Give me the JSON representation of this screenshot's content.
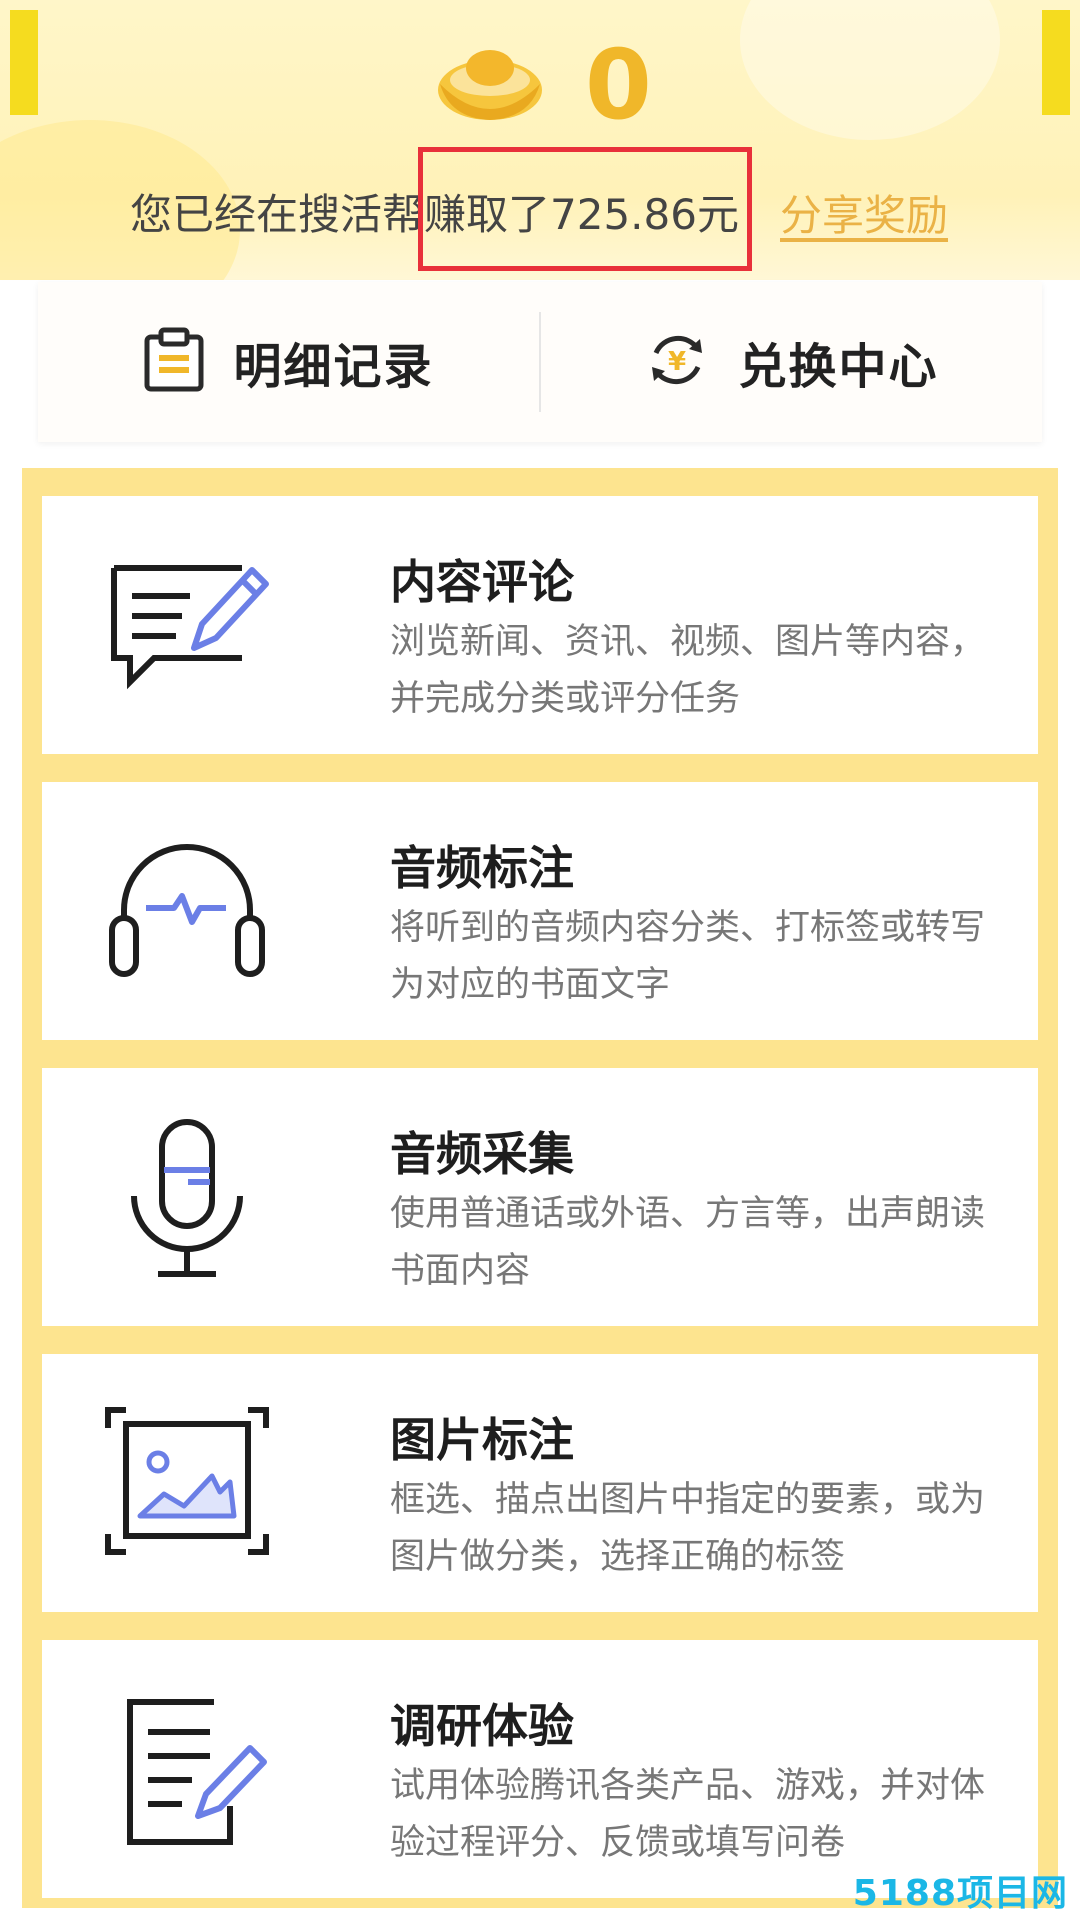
{
  "header": {
    "coin_value": "0",
    "earn_prefix": "您已经在搜活帮",
    "earn_highlight": "赚取了725.86元",
    "share_label": "分享奖励"
  },
  "actions": [
    {
      "label": "明细记录",
      "icon": "clipboard-icon"
    },
    {
      "label": "兑换中心",
      "icon": "yuan-exchange-icon"
    }
  ],
  "tasks": [
    {
      "title": "内容评论",
      "desc": "浏览新闻、资讯、视频、图片等内容，并完成分类或评分任务",
      "icon": "comment-edit-icon"
    },
    {
      "title": "音频标注",
      "desc": "将听到的音频内容分类、打标签或转写为对应的书面文字",
      "icon": "headphones-icon"
    },
    {
      "title": "音频采集",
      "desc": "使用普通话或外语、方言等，出声朗读书面内容",
      "icon": "microphone-icon"
    },
    {
      "title": "图片标注",
      "desc": "框选、描点出图片中指定的要素，或为图片做分类，选择正确的标签",
      "icon": "image-frame-icon"
    },
    {
      "title": "调研体验",
      "desc": "试用体验腾讯各类产品、游戏，并对体验过程评分、反馈或填写问卷",
      "icon": "survey-edit-icon"
    }
  ],
  "colors": {
    "accent": "#f0b72a",
    "panel": "#fde48f",
    "highlight": "#e8303a",
    "icon_blue": "#6b7fe6"
  },
  "watermark": "5188项目网"
}
